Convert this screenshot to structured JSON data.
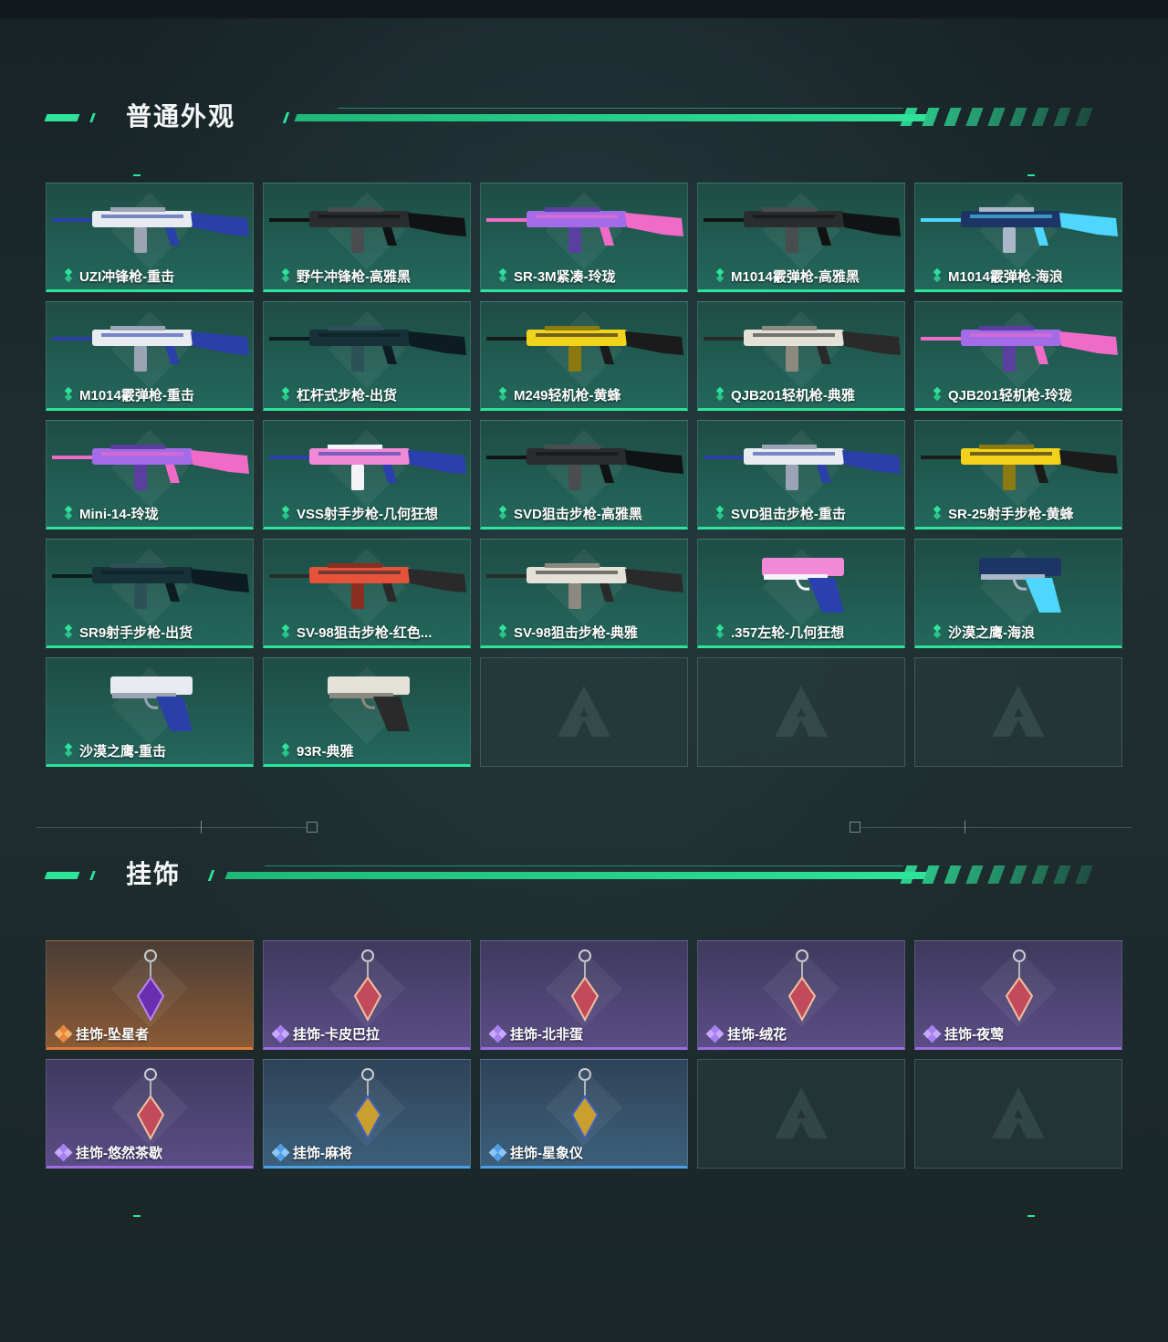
{
  "sections": [
    {
      "title": "普通外观"
    },
    {
      "title": "挂饰"
    }
  ],
  "weapons": [
    {
      "label": "UZI冲锋枪-重击",
      "skin": "white-blue"
    },
    {
      "label": "野牛冲锋枪-高雅黑",
      "skin": "black"
    },
    {
      "label": "SR-3M紧凑-玲珑",
      "skin": "purple-pink"
    },
    {
      "label": "M1014霰弹枪-高雅黑",
      "skin": "black"
    },
    {
      "label": "M1014霰弹枪-海浪",
      "skin": "navy-cyan"
    },
    {
      "label": "M1014霰弹枪-重击",
      "skin": "white-blue"
    },
    {
      "label": "杠杆式步枪-出货",
      "skin": "dark-teal"
    },
    {
      "label": "M249轻机枪-黄蜂",
      "skin": "yellow-black"
    },
    {
      "label": "QJB201轻机枪-典雅",
      "skin": "white-black"
    },
    {
      "label": "QJB201轻机枪-玲珑",
      "skin": "purple-pink"
    },
    {
      "label": "Mini-14-玲珑",
      "skin": "purple-pink"
    },
    {
      "label": "VSS射手步枪-几何狂想",
      "skin": "pink-blue"
    },
    {
      "label": "SVD狙击步枪-高雅黑",
      "skin": "black"
    },
    {
      "label": "SVD狙击步枪-重击",
      "skin": "white-blue"
    },
    {
      "label": "SR-25射手步枪-黄蜂",
      "skin": "yellow-black"
    },
    {
      "label": "SR9射手步枪-出货",
      "skin": "dark-teal"
    },
    {
      "label": "SV-98狙击步枪-红色...",
      "skin": "red"
    },
    {
      "label": "SV-98狙击步枪-典雅",
      "skin": "white-black"
    },
    {
      "label": ".357左轮-几何狂想",
      "skin": "pink-blue"
    },
    {
      "label": "沙漠之鹰-海浪",
      "skin": "navy-cyan"
    },
    {
      "label": "沙漠之鹰-重击",
      "skin": "white-blue"
    },
    {
      "label": "93R-典雅",
      "skin": "white-black"
    }
  ],
  "charms": [
    {
      "label": "挂饰-坠星者",
      "rarity": "orange"
    },
    {
      "label": "挂饰-卡皮巴拉",
      "rarity": "purple"
    },
    {
      "label": "挂饰-北非蛋",
      "rarity": "purple"
    },
    {
      "label": "挂饰-绒花",
      "rarity": "purple"
    },
    {
      "label": "挂饰-夜莺",
      "rarity": "purple"
    },
    {
      "label": "挂饰-悠然茶歇",
      "rarity": "purple"
    },
    {
      "label": "挂饰-麻将",
      "rarity": "blue"
    },
    {
      "label": "挂饰-星象仪",
      "rarity": "blue"
    }
  ],
  "colors": {
    "accent": "#2ee39a",
    "orange": "#e07a36",
    "purple": "#9b6fe0",
    "blue": "#4f9fe6"
  }
}
